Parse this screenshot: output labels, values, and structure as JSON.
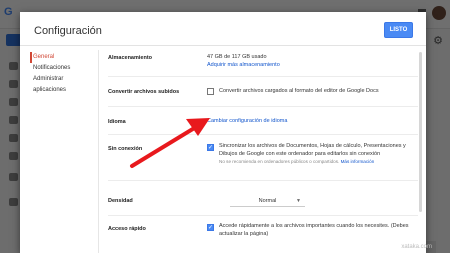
{
  "dialog": {
    "title": "Configuración",
    "done_label": "LISTO"
  },
  "nav": {
    "items": [
      "General",
      "Notificaciones",
      "Administrar aplicaciones"
    ]
  },
  "settings": {
    "storage": {
      "label": "Almacenamiento",
      "value": "47 GB de 117 GB usado",
      "link": "Adquirir más almacenamiento"
    },
    "convert": {
      "label": "Convertir archivos subidos",
      "text": "Convertir archivos cargados al formato del editor de Google Docs"
    },
    "language": {
      "label": "Idioma",
      "link": "Cambiar configuración de idioma"
    },
    "offline": {
      "label": "Sin conexión",
      "line1": "Sincronizar los archivos de Documentos, Hojas de cálculo, Presentaciones y",
      "line2": "Dibujos de Google con este ordenador para editarlos sin conexión",
      "note": "No se recomienda en ordenadores públicos o compartidos.",
      "note_link": "Más información"
    },
    "density": {
      "label": "Densidad",
      "value": "Normal"
    },
    "quick": {
      "label": "Acceso rápido",
      "line1": "Accede rápidamente a los archivos importantes cuando los necesites. (Debes",
      "line2": "actualizar la página)"
    }
  },
  "watermark": "xataka.com",
  "colors": {
    "accent": "#4a8af4",
    "nav_active": "#d14836",
    "arrow": "#e8191d"
  }
}
